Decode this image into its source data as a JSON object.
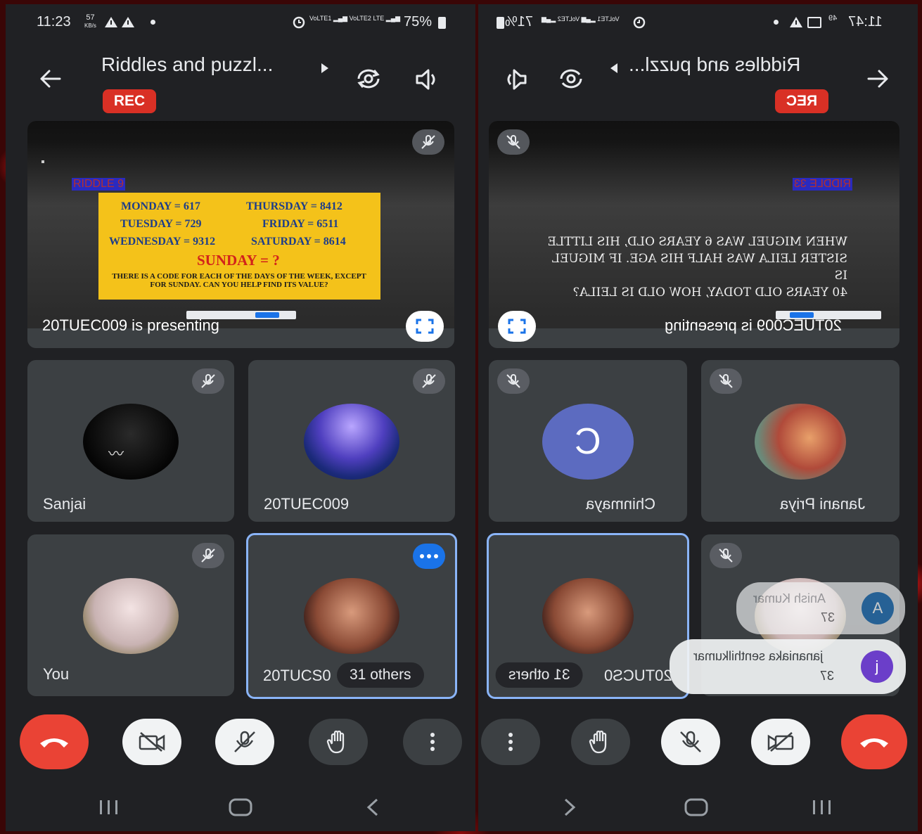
{
  "status_bar": {
    "time": "11:23",
    "speed": "57",
    "speed_unit": "KB/s",
    "network_label": "LTE",
    "battery": "75%",
    "mirrored_time": "11:47",
    "mirrored_speed": "49",
    "mirrored_battery": "71%"
  },
  "call": {
    "title": "Riddles and puzzl...",
    "rec_label": "REC",
    "presenting_text": "20TUEC009 is presenting"
  },
  "slide_left": {
    "riddle_label": "RIDDLE 9",
    "rows": [
      {
        "l": "MONDAY = 617",
        "r": "THURSDAY = 8412"
      },
      {
        "l": "TUESDAY = 729",
        "r": "FRIDAY = 6511"
      },
      {
        "l": "WEDNESDAY = 9312",
        "r": "SATURDAY = 8614"
      }
    ],
    "sunday": "SUNDAY = ?",
    "description": "THERE IS A CODE FOR EACH OF THE DAYS OF THE WEEK, EXCEPT FOR SUNDAY. CAN YOU HELP FIND ITS VALUE?"
  },
  "slide_right": {
    "riddle_label": "RIDDLE 33",
    "text_lines": [
      "WHEN MIGUEL WAS 6 YEARS OLD, HIS LITTLE",
      "SISTER LEILA WAS HALF HIS AGE. IF MIGUEL IS",
      "40 YEARS OLD TODAY, HOW OLD IS LEILA?"
    ]
  },
  "participants_left": {
    "sanjai": "Sanjai",
    "tuec": "20TUEC009",
    "you": "You",
    "tucs": "20TUCS0",
    "others": "31 others"
  },
  "participants_right": {
    "chinmaya": "Chinmaya",
    "chinmaya_initial": "C",
    "janani": "Janani Priya",
    "tucs": "20TUCS0",
    "others": "31 others"
  },
  "toasts": {
    "first_name": "Anish Kumar",
    "first_initial": "A",
    "first_count": "37",
    "second_name": "jananiaka senthilkumar",
    "second_initial": "j",
    "second_count": "37"
  },
  "colors": {
    "end_call": "#ea4335",
    "rec": "#d93025",
    "active_border": "#8ab4f8",
    "chinmaya_avatar": "#5c6bc0"
  }
}
